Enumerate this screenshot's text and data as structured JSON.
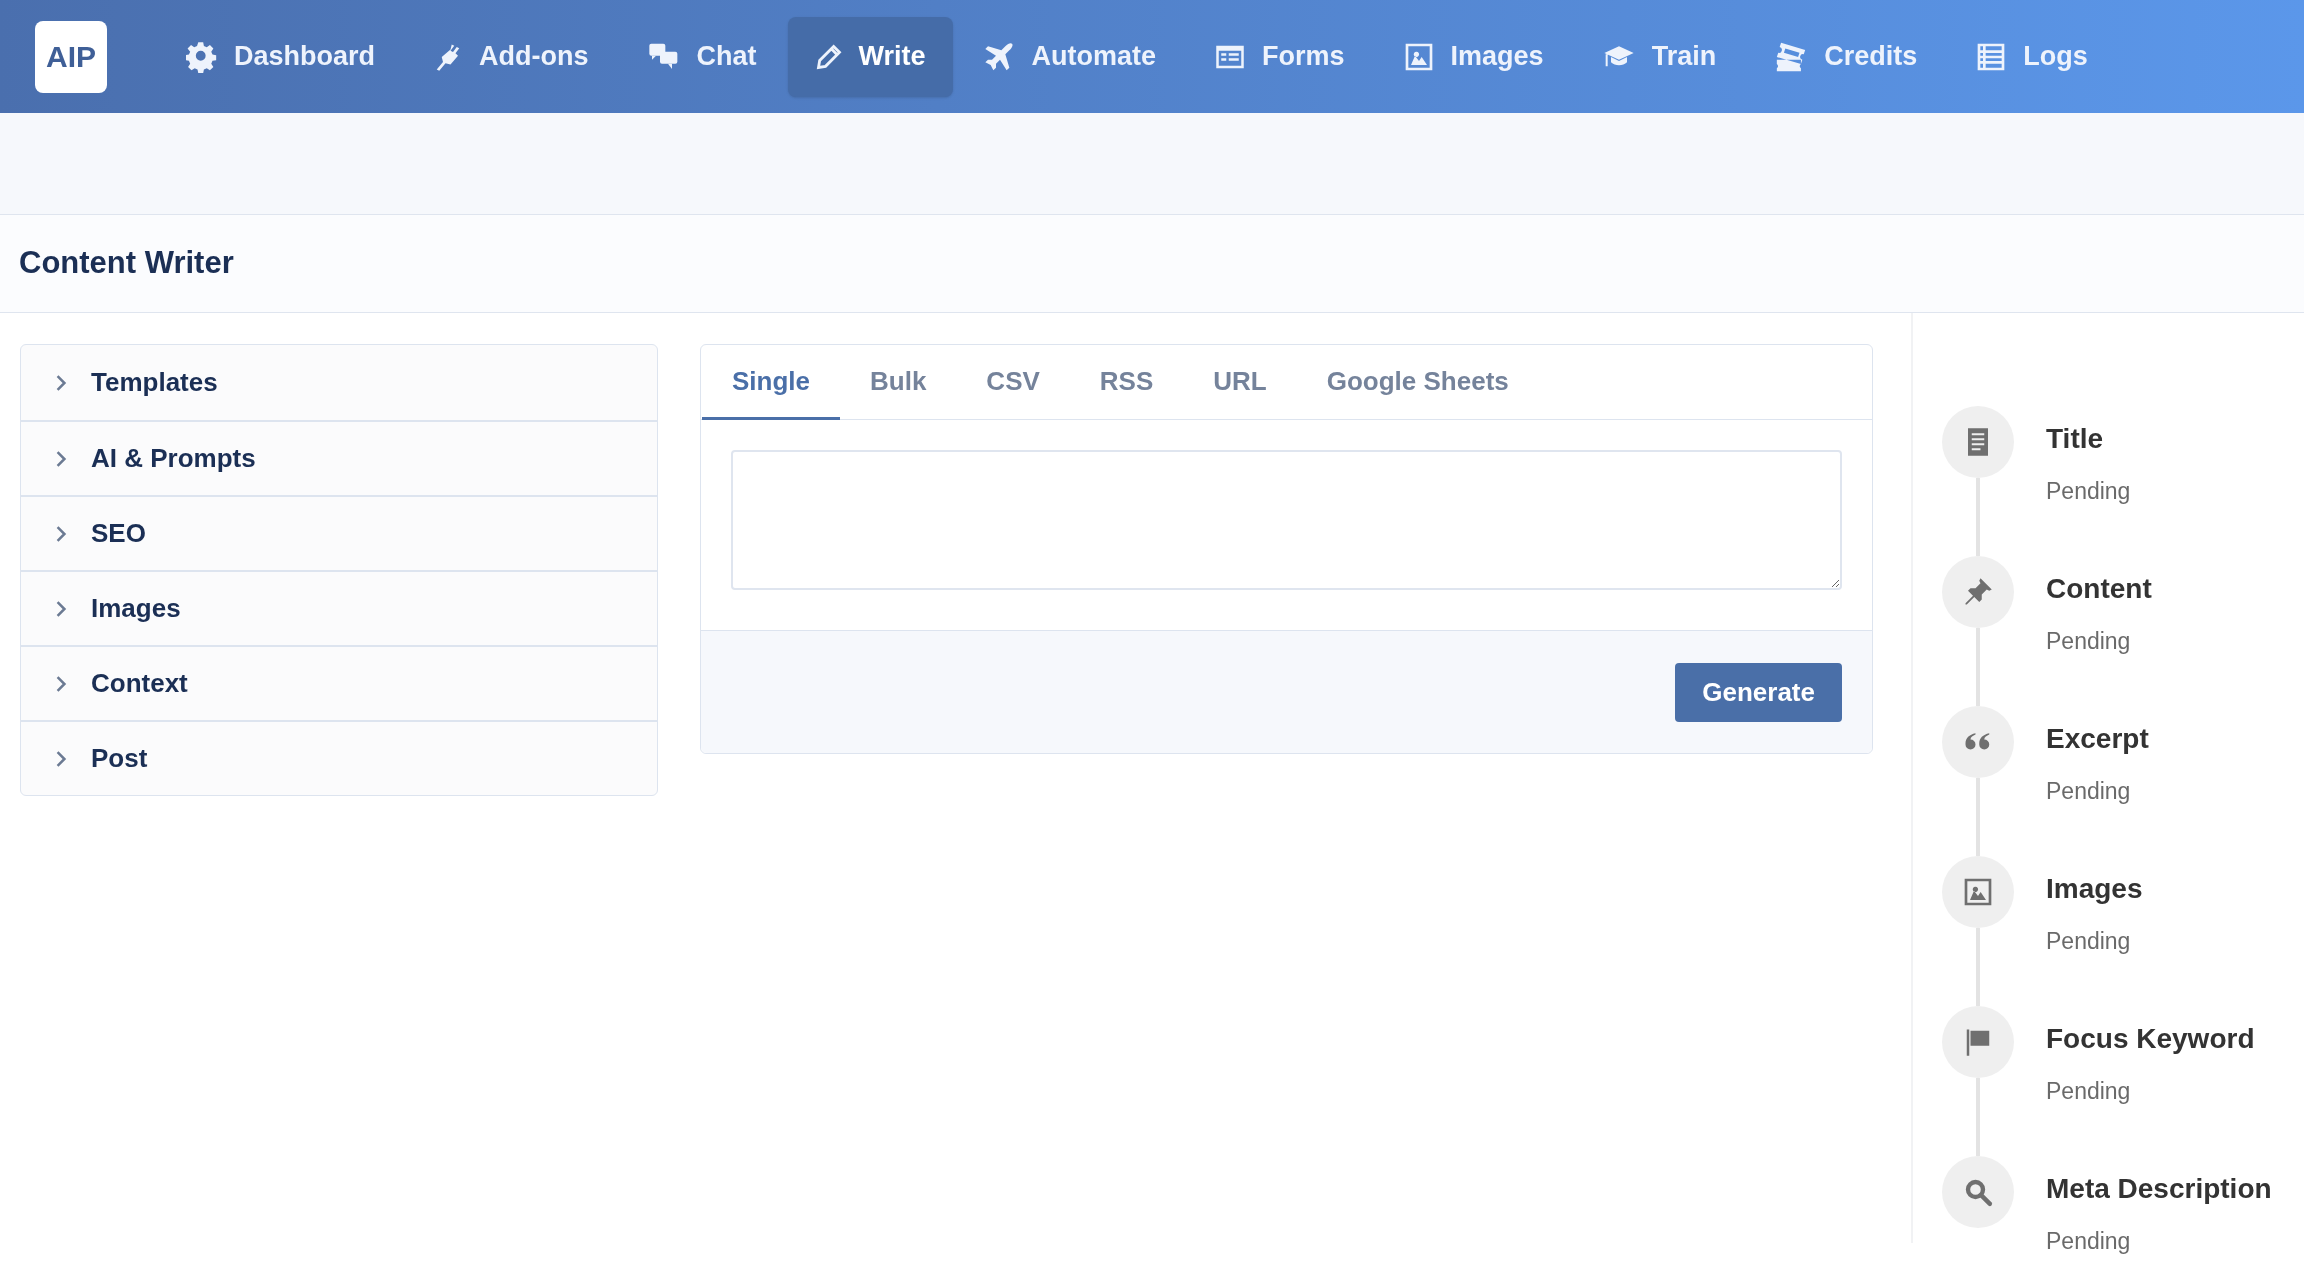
{
  "logo": "AIP",
  "nav": [
    {
      "label": "Dashboard",
      "selected": false
    },
    {
      "label": "Add-ons",
      "selected": false
    },
    {
      "label": "Chat",
      "selected": false
    },
    {
      "label": "Write",
      "selected": true
    },
    {
      "label": "Automate",
      "selected": false
    },
    {
      "label": "Forms",
      "selected": false
    },
    {
      "label": "Images",
      "selected": false
    },
    {
      "label": "Train",
      "selected": false
    },
    {
      "label": "Credits",
      "selected": false
    },
    {
      "label": "Logs",
      "selected": false
    }
  ],
  "page_title": "Content Writer",
  "sections": [
    {
      "label": "Templates",
      "expanded": false
    },
    {
      "label": "AI & Prompts",
      "expanded": false
    },
    {
      "label": "SEO",
      "expanded": false
    },
    {
      "label": "Images",
      "expanded": false
    },
    {
      "label": "Context",
      "expanded": false
    },
    {
      "label": "Post",
      "expanded": false
    }
  ],
  "tabs": [
    {
      "label": "Single",
      "selected": true
    },
    {
      "label": "Bulk",
      "selected": false
    },
    {
      "label": "CSV",
      "selected": false
    },
    {
      "label": "RSS",
      "selected": false
    },
    {
      "label": "URL",
      "selected": false
    },
    {
      "label": "Google Sheets",
      "selected": false
    }
  ],
  "generate_button": "Generate",
  "steps": [
    {
      "label": "Title",
      "status": "Pending"
    },
    {
      "label": "Content",
      "status": "Pending"
    },
    {
      "label": "Excerpt",
      "status": "Pending"
    },
    {
      "label": "Images",
      "status": "Pending"
    },
    {
      "label": "Focus Keyword",
      "status": "Pending"
    },
    {
      "label": "Meta Description",
      "status": "Pending"
    }
  ]
}
